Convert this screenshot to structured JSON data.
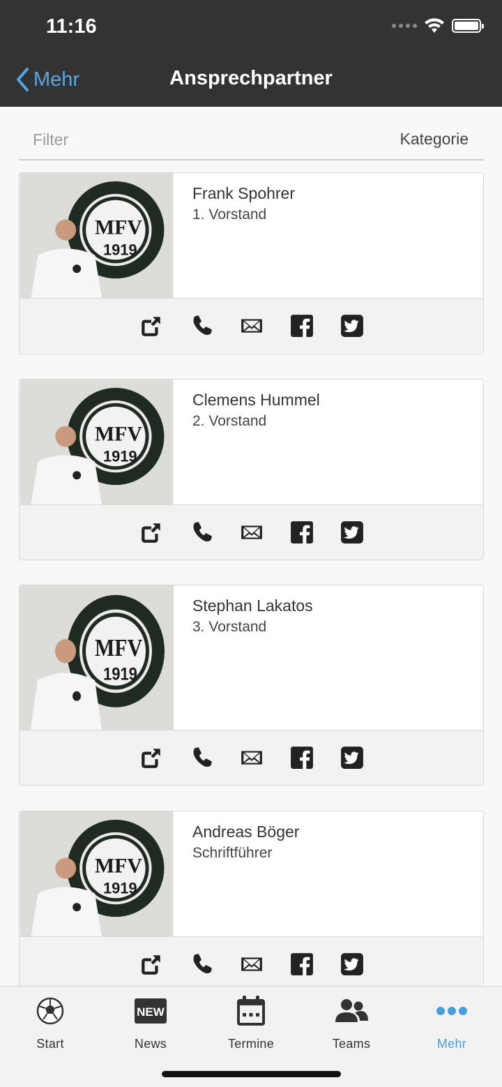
{
  "status": {
    "time": "11:16"
  },
  "nav": {
    "back_label": "Mehr",
    "title": "Ansprechpartner"
  },
  "filter": {
    "placeholder": "Filter",
    "category_label": "Kategorie"
  },
  "contacts": [
    {
      "name": "Frank Spohrer",
      "role": "1. Vorstand"
    },
    {
      "name": "Clemens Hummel",
      "role": "2. Vorstand"
    },
    {
      "name": "Stephan Lakatos",
      "role": "3. Vorstand"
    },
    {
      "name": "Andreas Böger",
      "role": "Schriftführer"
    }
  ],
  "contact_actions": [
    "external-link-icon",
    "phone-icon",
    "mail-icon",
    "facebook-icon",
    "twitter-icon"
  ],
  "photo_badge": {
    "letters": "MFV",
    "year": "1919"
  },
  "tabs": [
    {
      "label": "Start",
      "icon": "soccer-ball-icon"
    },
    {
      "label": "News",
      "icon": "news-icon"
    },
    {
      "label": "Termine",
      "icon": "calendar-icon"
    },
    {
      "label": "Teams",
      "icon": "teams-icon"
    },
    {
      "label": "Mehr",
      "icon": "more-icon"
    }
  ],
  "colors": {
    "header_bg": "#333333",
    "accent": "#4a9fd8",
    "back_link": "#5aa6e0"
  }
}
